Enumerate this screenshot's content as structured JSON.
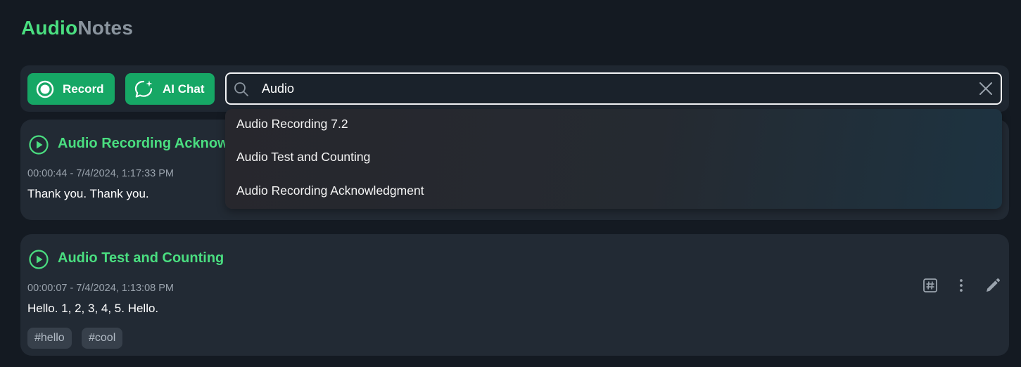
{
  "app": {
    "title_part1": "Audio",
    "title_part2": "Notes"
  },
  "toolbar": {
    "record_label": "Record",
    "ai_chat_label": "AI Chat",
    "search_value": "Audio"
  },
  "search_suggestions": [
    "Audio Recording 7.2",
    "Audio Test and Counting",
    "Audio Recording Acknowledgment"
  ],
  "notes": [
    {
      "title": "Audio Recording Acknowledgment",
      "meta": "00:00:44 - 7/4/2024, 1:17:33 PM",
      "transcript": "Thank you. Thank you."
    },
    {
      "title": "Audio Test and Counting",
      "meta": "00:00:07 - 7/4/2024, 1:13:08 PM",
      "transcript": "Hello. 1, 2, 3, 4, 5. Hello.",
      "tags": [
        "#hello",
        "#cool"
      ]
    }
  ],
  "colors": {
    "accent": "#4ade80",
    "button_bg": "#16a765",
    "background": "#141a22",
    "card": "#222a34"
  },
  "icons": [
    "record-icon",
    "ai-chat-icon",
    "search-icon",
    "close-icon",
    "play-icon",
    "hashtag-icon",
    "more-vertical-icon",
    "edit-icon"
  ]
}
